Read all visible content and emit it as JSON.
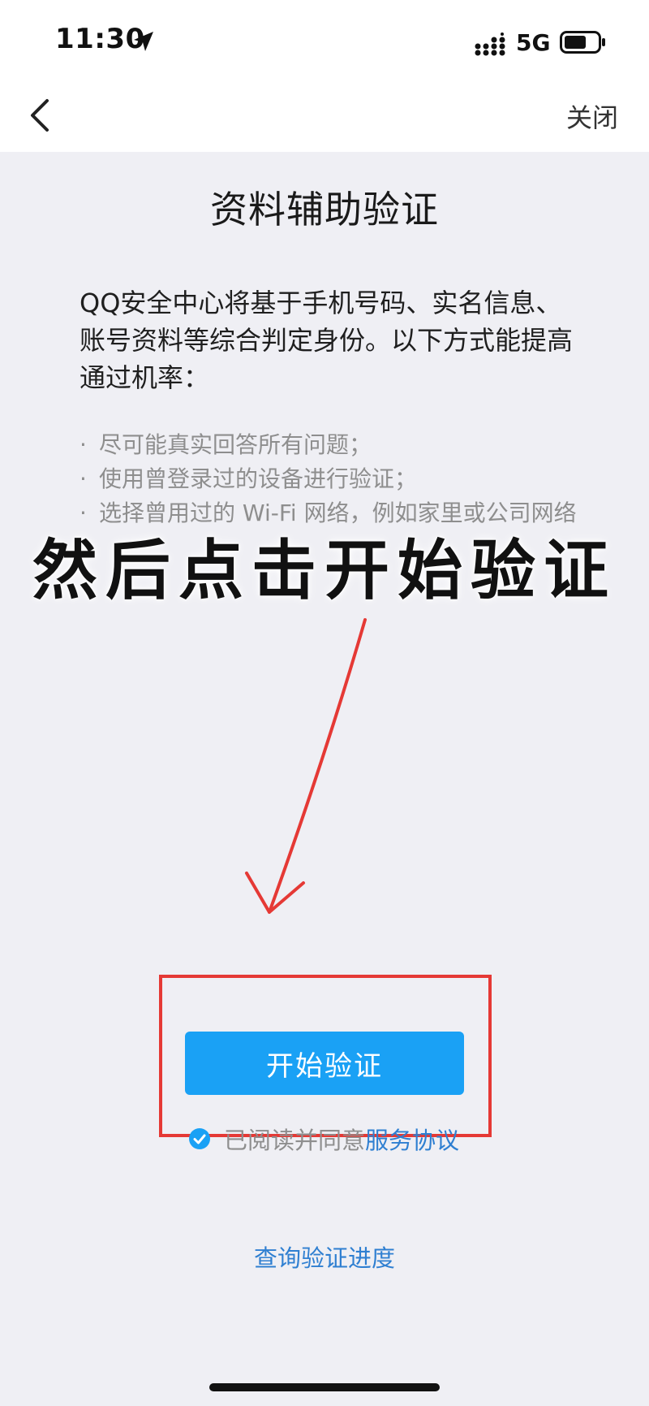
{
  "status_bar": {
    "time": "11:30",
    "network": "5G"
  },
  "nav": {
    "close_label": "关闭"
  },
  "main": {
    "title": "资料辅助验证",
    "intro": "QQ安全中心将基于手机号码、实名信息、账号资料等综合判定身份。以下方式能提高通过机率：",
    "tips": [
      "尽可能真实回答所有问题；",
      "使用曾登录过的设备进行验证；",
      "选择曾用过的 Wi-Fi 网络，例如家里或公司网络"
    ],
    "start_button_label": "开始验证",
    "agreement": {
      "text": "已阅读并同意",
      "link": "服务协议",
      "checked": true
    },
    "query_progress_link": "查询验证进度"
  },
  "overlay": {
    "caption": "然后点击开始验证"
  },
  "colors": {
    "accent": "#1aa1f5",
    "link": "#2f7fd1",
    "annotation": "#e53935"
  }
}
